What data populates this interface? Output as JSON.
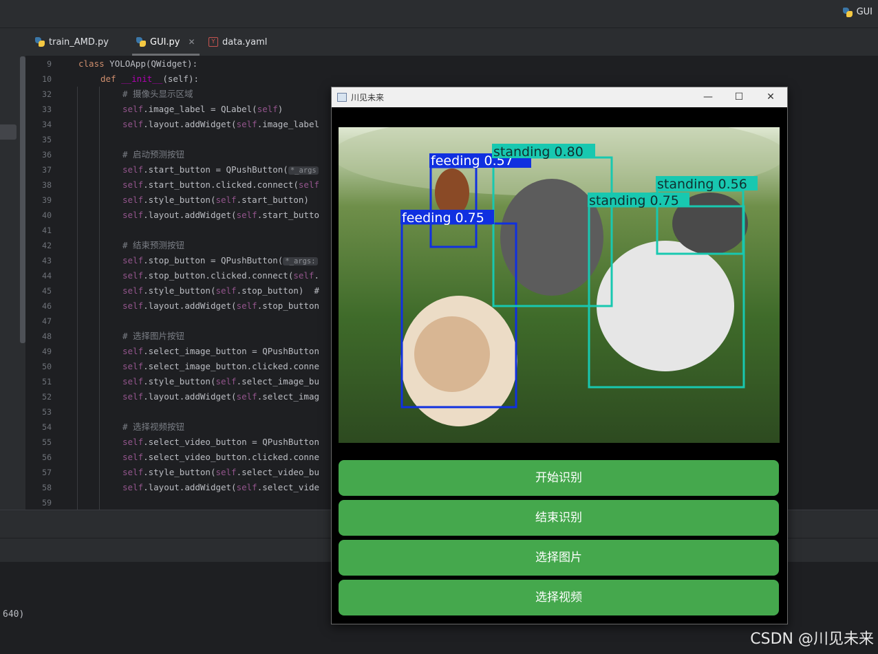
{
  "topbar": {
    "run_label": "GUI"
  },
  "tabs": [
    {
      "label": "train_AMD.py",
      "type": "py"
    },
    {
      "label": "GUI.py",
      "type": "py",
      "active": true
    },
    {
      "label": "data.yaml",
      "type": "yaml"
    }
  ],
  "sticky": [
    {
      "num": "9"
    },
    {
      "num": "10"
    }
  ],
  "lines": [
    {
      "num": "32"
    },
    {
      "num": "33"
    },
    {
      "num": "34"
    },
    {
      "num": "35"
    },
    {
      "num": "36"
    },
    {
      "num": "37"
    },
    {
      "num": "38"
    },
    {
      "num": "39"
    },
    {
      "num": "40"
    },
    {
      "num": "41"
    },
    {
      "num": "42"
    },
    {
      "num": "43"
    },
    {
      "num": "44"
    },
    {
      "num": "45"
    },
    {
      "num": "46"
    },
    {
      "num": "47"
    },
    {
      "num": "48"
    },
    {
      "num": "49"
    },
    {
      "num": "50"
    },
    {
      "num": "51"
    },
    {
      "num": "52"
    },
    {
      "num": "53"
    },
    {
      "num": "54"
    },
    {
      "num": "55"
    },
    {
      "num": "56"
    },
    {
      "num": "57"
    },
    {
      "num": "58"
    },
    {
      "num": "59"
    }
  ],
  "code": {
    "l9": {
      "kw": "class",
      "name": " YOLOApp(QWidget):"
    },
    "l10": {
      "kw": "def",
      "fn": "__init__",
      "rest": "(self):"
    },
    "c32": "# 摄像头显示区域",
    "c36": "# 启动预测按钮",
    "c42": "# 结束预测按钮",
    "c48": "# 选择图片按钮",
    "c54": "# 选择视频按钮",
    "self": "self",
    "l33": ".image_label = QLabel(",
    "l33b": ")",
    "l34": ".layout.addWidget(",
    "l34b": ".image_label",
    "l37": ".start_button = QPushButton(",
    "l37hint": "*_args",
    "l38": ".start_button.clicked.connect(",
    "l39": ".style_button(",
    "l39b": ".start_button)",
    "l40": ".layout.addWidget(",
    "l40b": ".start_butto",
    "l43": ".stop_button = QPushButton(",
    "l43hint": "*_args:",
    "l44": ".stop_button.clicked.connect(",
    "l44b": ".",
    "l45": ".style_button(",
    "l45b": ".stop_button)  #",
    "l46": ".layout.addWidget(",
    "l46b": ".stop_button",
    "l49": ".select_image_button = QPushButton",
    "l50": ".select_image_button.clicked.conne",
    "l51": ".style_button(",
    "l51b": ".select_image_bu",
    "l52": ".layout.addWidget(",
    "l52b": ".select_imag",
    "l55": ".select_video_button = QPushButton",
    "l56": ".select_video_button.clicked.conne",
    "l57": ".style_button(",
    "l57b": ".select_video_bu",
    "l58": ".layout.addWidget(",
    "l58b": ".select_vide"
  },
  "console": {
    "text": "640)"
  },
  "window": {
    "title": "川见未来",
    "minimize": "—",
    "maximize": "☐",
    "close": "✕",
    "buttons": {
      "start": "开始识别",
      "stop": "结束识别",
      "select_image": "选择图片",
      "select_video": "选择视频"
    }
  },
  "detections": [
    {
      "label": "feeding 0.57",
      "class": "feeding",
      "score": 0.57
    },
    {
      "label": "standing 0.80",
      "class": "standing",
      "score": 0.8
    },
    {
      "label": "standing 0.56",
      "class": "standing",
      "score": 0.56
    },
    {
      "label": "standing 0.75",
      "class": "standing",
      "score": 0.75
    },
    {
      "label": "feeding 0.75",
      "class": "feeding",
      "score": 0.75
    }
  ],
  "colors": {
    "feeding": "#1030e0",
    "standing": "#18c8b0",
    "button": "#45a84d"
  },
  "watermark": "CSDN @川见未来"
}
